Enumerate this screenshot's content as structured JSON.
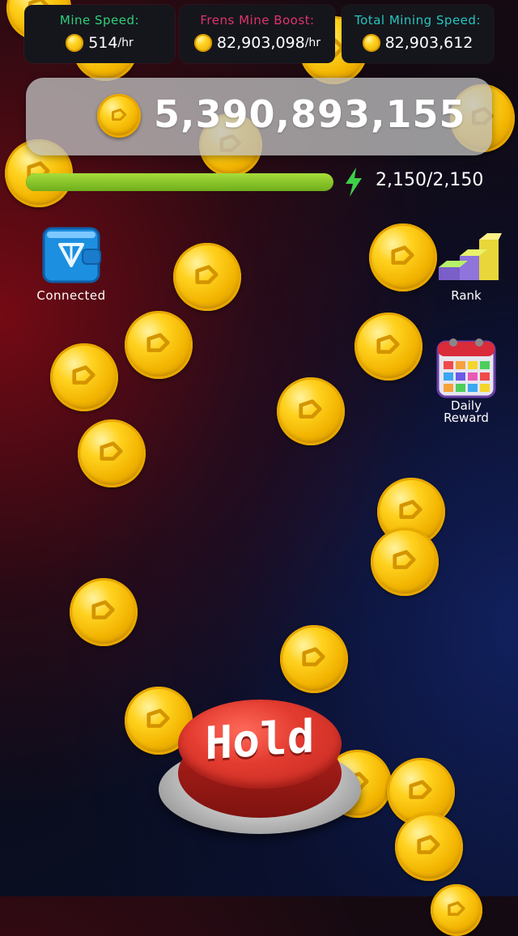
{
  "stats": {
    "mine_speed": {
      "label": "Mine Speed:",
      "value": "514",
      "unit": "/hr",
      "label_color": "#2fd07a"
    },
    "frens_boost": {
      "label": "Frens Mine Boost:",
      "value": "82,903,098",
      "unit": "/hr",
      "label_color": "#e0336b"
    },
    "total_speed": {
      "label": "Total Mining Speed:",
      "value": "82,903,612",
      "label_color": "#25c6c0"
    }
  },
  "balance": {
    "value": "5,390,893,155"
  },
  "energy": {
    "text": "2,150/2,150",
    "current": 2150,
    "max": 2150,
    "fraction": 1.0
  },
  "side_menu": {
    "wallet_label": "Connected",
    "rank_label": "Rank",
    "daily_reward_line1": "Daily",
    "daily_reward_line2": "Reward"
  },
  "hold_button": {
    "label": "Hold"
  },
  "icons": [
    "coin-icon",
    "lightning-icon",
    "wallet-icon",
    "rank-stairs-icon",
    "calendar-icon"
  ],
  "colors": {
    "energy_bar": "#8fcf2a",
    "hold_button": "#d8322b",
    "coin": "#f2b400"
  }
}
